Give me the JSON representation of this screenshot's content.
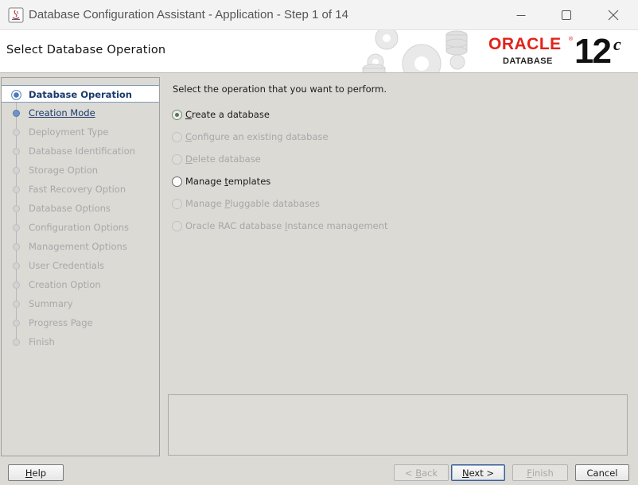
{
  "window": {
    "title": "Database Configuration Assistant - Application - Step 1 of 14"
  },
  "header": {
    "title": "Select Database Operation",
    "logo_brand": "ORACLE",
    "logo_product": "DATABASE",
    "logo_version": "12",
    "logo_version_suffix": "c"
  },
  "nav": {
    "items": [
      {
        "label": "Database Operation",
        "state": "active"
      },
      {
        "label": "Creation Mode",
        "state": "next"
      },
      {
        "label": "Deployment Type",
        "state": "disabled"
      },
      {
        "label": "Database Identification",
        "state": "disabled"
      },
      {
        "label": "Storage Option",
        "state": "disabled"
      },
      {
        "label": "Fast Recovery Option",
        "state": "disabled"
      },
      {
        "label": "Database Options",
        "state": "disabled"
      },
      {
        "label": "Configuration Options",
        "state": "disabled"
      },
      {
        "label": "Management Options",
        "state": "disabled"
      },
      {
        "label": "User Credentials",
        "state": "disabled"
      },
      {
        "label": "Creation Option",
        "state": "disabled"
      },
      {
        "label": "Summary",
        "state": "disabled"
      },
      {
        "label": "Progress Page",
        "state": "disabled"
      },
      {
        "label": "Finish",
        "state": "disabled"
      }
    ]
  },
  "main": {
    "prompt": "Select the operation that you want to perform.",
    "options": [
      {
        "before": "",
        "mnemonic": "C",
        "after": "reate a database",
        "selected": true,
        "enabled": true
      },
      {
        "before": "",
        "mnemonic": "C",
        "after": "onfigure an existing database",
        "selected": false,
        "enabled": false
      },
      {
        "before": "",
        "mnemonic": "D",
        "after": "elete database",
        "selected": false,
        "enabled": false
      },
      {
        "before": "Manage ",
        "mnemonic": "t",
        "after": "emplates",
        "selected": false,
        "enabled": true
      },
      {
        "before": "Manage ",
        "mnemonic": "P",
        "after": "luggable databases",
        "selected": false,
        "enabled": false
      },
      {
        "before": "Oracle RAC database ",
        "mnemonic": "I",
        "after": "nstance management",
        "selected": false,
        "enabled": false
      }
    ]
  },
  "buttons": {
    "help": {
      "mnemonic": "H",
      "rest": "elp"
    },
    "back": {
      "prefix": "< ",
      "mnemonic": "B",
      "rest": "ack"
    },
    "next": {
      "mnemonic": "N",
      "rest": "ext >"
    },
    "finish": {
      "mnemonic": "F",
      "rest": "inish"
    },
    "cancel": {
      "label": "Cancel"
    }
  },
  "colors": {
    "oracle_red": "#e2231a",
    "nav_active_text": "#1a3b6e",
    "disabled_text": "#a8a8a8",
    "window_bg": "#dcdad5"
  }
}
